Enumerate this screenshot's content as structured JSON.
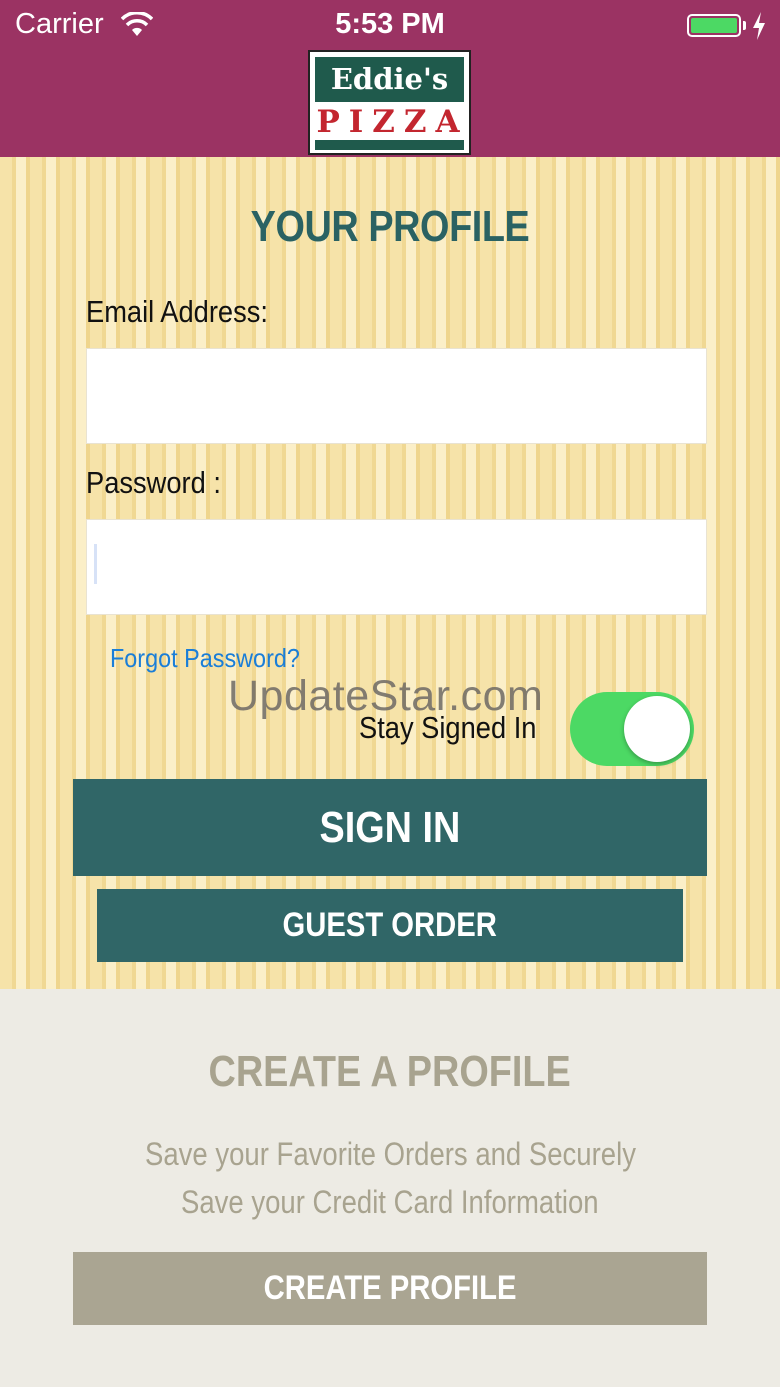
{
  "status_bar": {
    "carrier": "Carrier",
    "time": "5:53 PM"
  },
  "logo": {
    "line1": "Eddie's",
    "line2": "PIZZA"
  },
  "profile": {
    "title": "YOUR PROFILE",
    "email_label": "Email Address:",
    "email_value": "",
    "password_label": "Password :",
    "password_value": "",
    "forgot_password": "Forgot Password?",
    "stay_signed_in": "Stay Signed In",
    "stay_signed_in_on": true,
    "sign_in": "SIGN IN",
    "guest_order": "GUEST ORDER"
  },
  "watermark": "UpdateStar.com",
  "create": {
    "title": "CREATE A PROFILE",
    "desc_line1": "Save your Favorite Orders and Securely",
    "desc_line2": "Save your Credit Card Information",
    "button": "CREATE PROFILE"
  },
  "colors": {
    "header": "#9b3363",
    "accent": "#306667",
    "toggle_on": "#4cd964",
    "link": "#1a7ed8"
  }
}
